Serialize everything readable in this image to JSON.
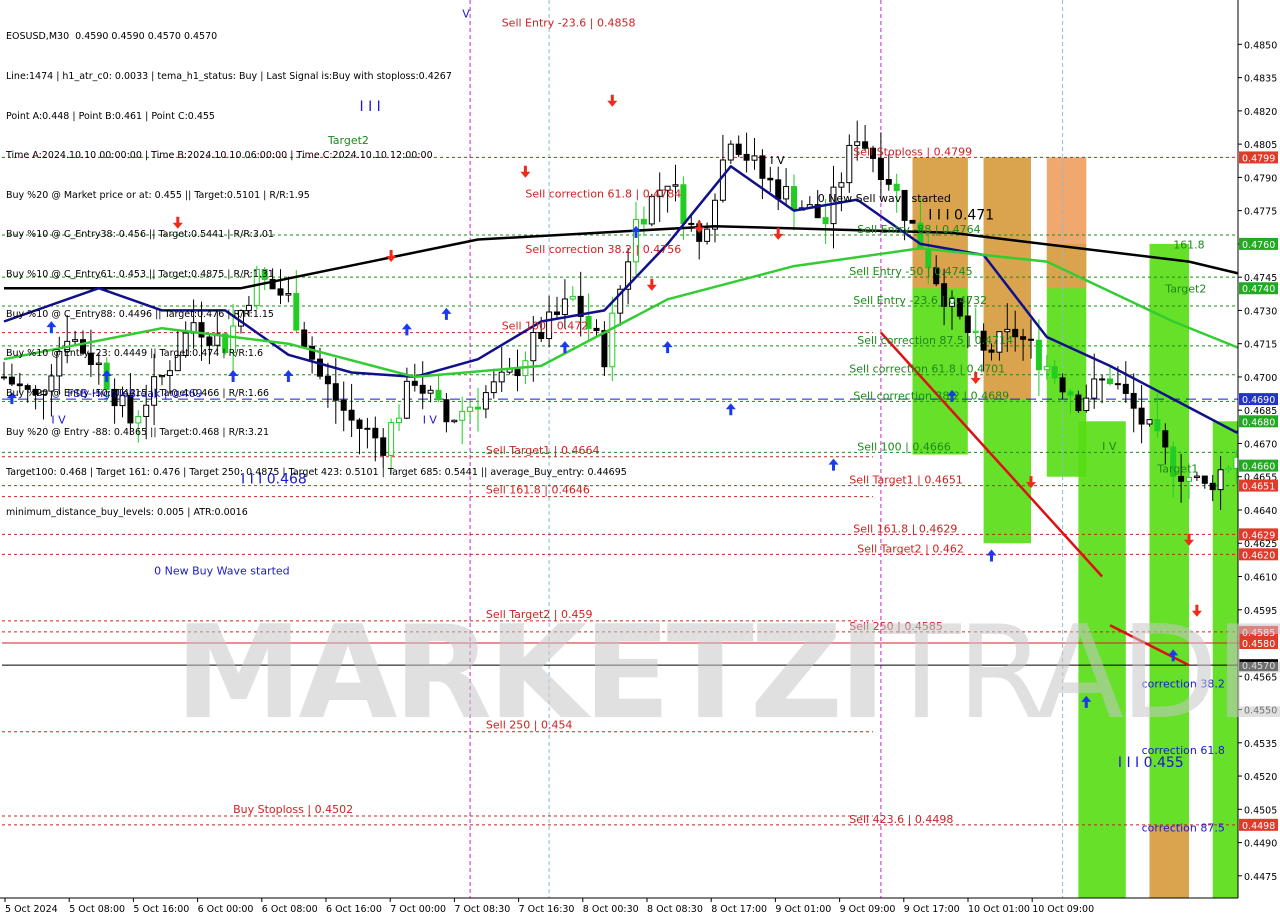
{
  "symbol": "EOSUSD,M30",
  "ohlc": "0.4590 0.4590 0.4570 0.4570",
  "info_lines": [
    "Line:1474 | h1_atr_c0: 0.0033 | tema_h1_status: Buy | Last Signal is:Buy with stoploss:0.4267",
    "Point A:0.448 | Point B:0.461 | Point C:0.455",
    "Time A:2024.10.10 00:00:00 | Time B:2024.10.10 06:00:00 | Time C:2024.10.10 12:00:00",
    "Buy %20 @ Market price or at: 0.455 || Target:0.5101 | R/R:1.95",
    "Buy %10 @ C_Entry38: 0.456 || Target:0.5441 | R/R:3.01",
    "Buy %10 @ C_Entry61: 0.453 || Target:0.4875 | R/R:1.31",
    "Buy %10 @ C_Entry88: 0.4496 || Target:0.476 | R/R:1.15",
    "Buy %10 @ Entry -23: 0.4449 || Target:0.474 | R/R:1.6",
    "Buy %20 @ Entry -50: 0.4415 || Target:0.466 | R/R:1.66",
    "Buy %20 @ Entry -88: 0.4365 || Target:0.468 | R/R:3.21",
    "Target100: 0.468 | Target 161: 0.476 | Target 250: 0.4875 | Target 423: 0.5101 | Target 685: 0.5441 || average_Buy_entry: 0.44695",
    "minimum_distance_buy_levels: 0.005 | ATR:0.0016"
  ],
  "watermark": {
    "bold": "MARKETZI",
    "light": "TRADE"
  },
  "colors": {
    "background": "#ffffff",
    "candle": "#000000",
    "candle_green": "#22cc22",
    "ma_black": "#000000",
    "ma_navy": "#10108a",
    "ma_green": "#33cc33",
    "level_red": "#cc2222",
    "level_green": "#1a8a1a",
    "level_blue": "#1a1acc",
    "zone_green": "#55dd11",
    "zone_orange": "#ee9955",
    "price_label_red": "#e03a2a",
    "price_label_green": "#22aa22",
    "price_label_blue": "#2233cc",
    "price_label_black": "#000000",
    "signal_up": "#1a3aee",
    "signal_down": "#ee2a1a"
  },
  "chart_data": {
    "type": "candlestick",
    "symbol": "EOSUSD",
    "timeframe": "M30",
    "ylim": [
      0.4465,
      0.487
    ],
    "y_ticks": [
      "0.4850",
      "0.4835",
      "0.4820",
      "0.4805",
      "0.4790",
      "0.4775",
      "0.4760",
      "0.4745",
      "0.4730",
      "0.4715",
      "0.4700",
      "0.4685",
      "0.4670",
      "0.4655",
      "0.4640",
      "0.4625",
      "0.4610",
      "0.4595",
      "0.4580",
      "0.4565",
      "0.4550",
      "0.4535",
      "0.4520",
      "0.4505",
      "0.4490",
      "0.4475"
    ],
    "x_labels": [
      "5 Oct 2024",
      "5 Oct 08:00",
      "5 Oct 16:00",
      "6 Oct 00:00",
      "6 Oct 08:00",
      "6 Oct 16:00",
      "7 Oct 00:00",
      "7 Oct 08:30",
      "7 Oct 16:30",
      "8 Oct 00:30",
      "8 Oct 08:30",
      "8 Oct 17:00",
      "9 Oct 01:00",
      "9 Oct 09:00",
      "9 Oct 17:00",
      "10 Oct 01:00",
      "10 Oct 09:00"
    ],
    "current_price": 0.457,
    "close_path": [
      [
        0,
        0.47
      ],
      [
        4,
        0.469
      ],
      [
        8,
        0.472
      ],
      [
        12,
        0.4705
      ],
      [
        16,
        0.468
      ],
      [
        20,
        0.47
      ],
      [
        24,
        0.4725
      ],
      [
        28,
        0.4715
      ],
      [
        32,
        0.4745
      ],
      [
        36,
        0.4735
      ],
      [
        40,
        0.47
      ],
      [
        44,
        0.468
      ],
      [
        48,
        0.467
      ],
      [
        52,
        0.47
      ],
      [
        56,
        0.468
      ],
      [
        60,
        0.469
      ],
      [
        64,
        0.47
      ],
      [
        68,
        0.472
      ],
      [
        72,
        0.4735
      ],
      [
        76,
        0.471
      ],
      [
        80,
        0.477
      ],
      [
        84,
        0.479
      ],
      [
        88,
        0.476
      ],
      [
        92,
        0.481
      ],
      [
        96,
        0.479
      ],
      [
        100,
        0.478
      ],
      [
        104,
        0.477
      ],
      [
        108,
        0.481
      ],
      [
        112,
        0.479
      ],
      [
        116,
        0.476
      ],
      [
        120,
        0.473
      ],
      [
        124,
        0.471
      ],
      [
        128,
        0.472
      ],
      [
        132,
        0.4705
      ],
      [
        136,
        0.469
      ],
      [
        140,
        0.47
      ],
      [
        144,
        0.468
      ],
      [
        148,
        0.466
      ],
      [
        152,
        0.465
      ],
      [
        156,
        0.4665
      ],
      [
        160,
        0.468
      ],
      [
        164,
        0.469
      ],
      [
        168,
        0.47
      ],
      [
        172,
        0.4695
      ],
      [
        176,
        0.469
      ],
      [
        180,
        0.468
      ],
      [
        184,
        0.467
      ],
      [
        188,
        0.466
      ],
      [
        192,
        0.465
      ],
      [
        196,
        0.464
      ],
      [
        200,
        0.4625
      ],
      [
        204,
        0.46
      ],
      [
        208,
        0.456
      ],
      [
        212,
        0.451
      ],
      [
        216,
        0.453
      ],
      [
        220,
        0.456
      ],
      [
        224,
        0.459
      ],
      [
        228,
        0.46
      ],
      [
        232,
        0.459
      ],
      [
        236,
        0.461
      ],
      [
        240,
        0.46
      ],
      [
        244,
        0.459
      ],
      [
        248,
        0.457
      ]
    ],
    "moving_averages": [
      {
        "color": "black",
        "points": [
          [
            0,
            0.474
          ],
          [
            30,
            0.474
          ],
          [
            60,
            0.4762
          ],
          [
            90,
            0.4768
          ],
          [
            120,
            0.4765
          ],
          [
            150,
            0.4752
          ],
          [
            170,
            0.4735
          ],
          [
            190,
            0.4712
          ],
          [
            205,
            0.4688
          ],
          [
            220,
            0.4674
          ]
        ]
      },
      {
        "color": "navy",
        "points": [
          [
            0,
            0.4725
          ],
          [
            12,
            0.474
          ],
          [
            20,
            0.473
          ],
          [
            28,
            0.473
          ],
          [
            36,
            0.471
          ],
          [
            44,
            0.4702
          ],
          [
            52,
            0.47
          ],
          [
            60,
            0.4708
          ],
          [
            68,
            0.4725
          ],
          [
            76,
            0.473
          ],
          [
            84,
            0.476
          ],
          [
            92,
            0.4795
          ],
          [
            100,
            0.4775
          ],
          [
            108,
            0.478
          ],
          [
            116,
            0.476
          ],
          [
            124,
            0.4755
          ],
          [
            132,
            0.4718
          ],
          [
            140,
            0.4705
          ],
          [
            148,
            0.469
          ],
          [
            156,
            0.4675
          ],
          [
            164,
            0.469
          ],
          [
            172,
            0.4695
          ],
          [
            180,
            0.4692
          ],
          [
            188,
            0.469
          ],
          [
            196,
            0.467
          ],
          [
            204,
            0.4625
          ],
          [
            210,
            0.46
          ],
          [
            218,
            0.459
          ],
          [
            226,
            0.459
          ],
          [
            234,
            0.459
          ],
          [
            240,
            0.4592
          ],
          [
            244,
            0.4598
          ],
          [
            248,
            0.459
          ]
        ]
      },
      {
        "color": "green",
        "points": [
          [
            0,
            0.4708
          ],
          [
            20,
            0.4722
          ],
          [
            36,
            0.4715
          ],
          [
            52,
            0.47
          ],
          [
            68,
            0.4705
          ],
          [
            84,
            0.4735
          ],
          [
            100,
            0.475
          ],
          [
            116,
            0.4758
          ],
          [
            132,
            0.4752
          ],
          [
            148,
            0.4725
          ],
          [
            164,
            0.4702
          ],
          [
            180,
            0.47
          ],
          [
            196,
            0.469
          ],
          [
            208,
            0.466
          ],
          [
            220,
            0.4625
          ],
          [
            232,
            0.461
          ],
          [
            242,
            0.46
          ],
          [
            248,
            0.4595
          ]
        ]
      }
    ],
    "levels": [
      {
        "name": "FSB-HighToBreak",
        "price": 0.469,
        "color": "blue",
        "style": "dash",
        "label": "FSB-HighToBreak | 0.469",
        "tag": "0.4690"
      },
      {
        "name": "Sell Stoploss",
        "price": 0.4799,
        "color": "red",
        "style": "dot",
        "label": "Sell Stoploss | 0.4799",
        "tag": "0.4799"
      },
      {
        "name": "Sell Entry -88",
        "price": 0.4764,
        "color": "green",
        "style": "dot",
        "label": "Sell Entry -88 | 0.4764",
        "tag": "0.4760"
      },
      {
        "name": "Sell Entry -50",
        "price": 0.4745,
        "color": "green",
        "style": "dot",
        "label": "Sell Entry -50 | 0.4745",
        "tag": "0.4740"
      },
      {
        "name": "Sell Entry -23.6",
        "price": 0.4732,
        "color": "green",
        "style": "dot",
        "label": "Sell Entry -23.6 | 0.4732",
        "tag": ""
      },
      {
        "name": "Sell correction 87.5",
        "price": 0.4714,
        "color": "green",
        "style": "dot",
        "label": "Sell correction 87.5 | 0.4714",
        "tag": ""
      },
      {
        "name": "Sell correction 61.8",
        "price": 0.4701,
        "color": "green",
        "style": "dot",
        "label": "Sell correction 61.8 | 0.4701",
        "tag": ""
      },
      {
        "name": "Sell correction 38.2",
        "price": 0.4689,
        "color": "green",
        "style": "dot",
        "label": "Sell correction 38.2 | 0.4689",
        "tag": "0.4680"
      },
      {
        "name": "Sell 100",
        "price": 0.4666,
        "color": "green",
        "style": "dot",
        "label": "Sell 100 | 0.4666",
        "tag": "0.4660"
      },
      {
        "name": "Sell Target1",
        "price": 0.4651,
        "color": "red",
        "style": "dot",
        "label": "Sell Target1 | 0.4651",
        "tag": "0.4651"
      },
      {
        "name": "Sell 161.8",
        "price": 0.4629,
        "color": "red",
        "style": "dot",
        "label": "Sell 161.8 | 0.4629",
        "tag": "0.4629"
      },
      {
        "name": "Sell Target2",
        "price": 0.462,
        "color": "red",
        "style": "dot",
        "label": "Sell Target2 | 0.462",
        "tag": "0.4620"
      },
      {
        "name": "Sell 250",
        "price": 0.4585,
        "color": "red",
        "style": "dot",
        "label": "Sell 250 | 0.4585",
        "tag": "0.4585"
      },
      {
        "name": "Current",
        "price": 0.458,
        "color": "red",
        "style": "solid",
        "label": "",
        "tag": "0.4580"
      },
      {
        "name": "Bid",
        "price": 0.457,
        "color": "black",
        "style": "solid",
        "label": "",
        "tag": "0.4570"
      },
      {
        "name": "Sell 423.6",
        "price": 0.4498,
        "color": "red",
        "style": "dot",
        "label": "Sell 423.6 | 0.4498",
        "tag": "0.4498"
      }
    ],
    "old_levels": [
      {
        "price": 0.4664,
        "label": "Sell Target1 | 0.4664"
      },
      {
        "price": 0.4646,
        "label": "Sell 161.8 | 0.4646"
      },
      {
        "price": 0.459,
        "label": "Sell Target2 | 0.459"
      },
      {
        "price": 0.454,
        "label": "Sell 250 | 0.454"
      },
      {
        "price": 0.4502,
        "label": "Buy Stoploss | 0.4502"
      },
      {
        "price": 0.472,
        "label": "Sell 100 | 0.472"
      }
    ],
    "text_annotations": [
      {
        "text": "Sell Entry -23.6 | 0.4858",
        "x": 63,
        "y": 0.4858,
        "color": "red"
      },
      {
        "text": "Sell correction 61.8 | 0.4784",
        "x": 66,
        "y": 0.4781,
        "color": "red"
      },
      {
        "text": "Sell correction 38.2 | 0.4756",
        "x": 66,
        "y": 0.4756,
        "color": "red"
      },
      {
        "text": "0 New Sell wave started",
        "x": 103,
        "y": 0.4779,
        "color": "black"
      },
      {
        "text": "0 New Buy Wave started",
        "x": 19,
        "y": 0.4611,
        "color": "blue"
      },
      {
        "text": "I I I 0.471",
        "x": 117,
        "y": 0.4771,
        "color": "black"
      },
      {
        "text": "I I I 0.468",
        "x": 30,
        "y": 0.4652,
        "color": "blue"
      },
      {
        "text": "I I I 0.455",
        "x": 141,
        "y": 0.4524,
        "color": "blue"
      },
      {
        "text": "I V",
        "x": 6,
        "y": 0.4679,
        "color": "blue"
      },
      {
        "text": "I V",
        "x": 53,
        "y": 0.4679,
        "color": "blue"
      },
      {
        "text": "I V",
        "x": 97,
        "y": 0.4796,
        "color": "black"
      },
      {
        "text": "I V",
        "x": 139,
        "y": 0.4667,
        "color": "green"
      },
      {
        "text": "I I I",
        "x": 45,
        "y": 0.482,
        "color": "blue"
      },
      {
        "text": "V",
        "x": 58,
        "y": 0.4862,
        "color": "blue"
      },
      {
        "text": "Target2",
        "x": 41,
        "y": 0.4805,
        "color": "green"
      },
      {
        "text": "161.8",
        "x": 148,
        "y": 0.4758,
        "color": "green"
      },
      {
        "text": "Target2",
        "x": 147,
        "y": 0.4738,
        "color": "green"
      },
      {
        "text": "Target1",
        "x": 146,
        "y": 0.4657,
        "color": "green"
      },
      {
        "text": "correction 38.2",
        "x": 144,
        "y": 0.456,
        "color": "blue"
      },
      {
        "text": "correction 61.8",
        "x": 144,
        "y": 0.453,
        "color": "blue"
      },
      {
        "text": "correction 87.5",
        "x": 144,
        "y": 0.4495,
        "color": "blue"
      }
    ],
    "zones": [
      {
        "x0": 115,
        "x1": 122,
        "y0": 0.4665,
        "y1": 0.4799,
        "color": "green"
      },
      {
        "x0": 115,
        "x1": 122,
        "y0": 0.474,
        "y1": 0.4799,
        "color": "orange"
      },
      {
        "x0": 124,
        "x1": 130,
        "y0": 0.4625,
        "y1": 0.4799,
        "color": "green"
      },
      {
        "x0": 124,
        "x1": 130,
        "y0": 0.469,
        "y1": 0.4799,
        "color": "orange"
      },
      {
        "x0": 132,
        "x1": 137,
        "y0": 0.4655,
        "y1": 0.476,
        "color": "green"
      },
      {
        "x0": 132,
        "x1": 137,
        "y0": 0.474,
        "y1": 0.4799,
        "color": "orange"
      },
      {
        "x0": 136,
        "x1": 142,
        "y0": 0.4465,
        "y1": 0.468,
        "color": "green"
      },
      {
        "x0": 145,
        "x1": 150,
        "y0": 0.4465,
        "y1": 0.476,
        "color": "green"
      },
      {
        "x0": 145,
        "x1": 150,
        "y0": 0.4465,
        "y1": 0.4498,
        "color": "orange"
      },
      {
        "x0": 153,
        "x1": 158,
        "y0": 0.4465,
        "y1": 0.468,
        "color": "green"
      }
    ],
    "trend_lines": [
      {
        "x0": 111,
        "y0": 0.472,
        "x1": 139,
        "y1": 0.461
      },
      {
        "x0": 140,
        "y0": 0.4588,
        "x1": 150,
        "y1": 0.457
      }
    ],
    "vertical_lines": [
      {
        "x": 59,
        "color": "magenta"
      },
      {
        "x": 111,
        "color": "magenta"
      },
      {
        "x": 69,
        "color": "lightblue"
      },
      {
        "x": 134,
        "color": "lightblue"
      }
    ],
    "signals": [
      {
        "x": 1,
        "y": 0.469,
        "dir": "up"
      },
      {
        "x": 6,
        "y": 0.4722,
        "dir": "up"
      },
      {
        "x": 13,
        "y": 0.47,
        "dir": "up"
      },
      {
        "x": 29,
        "y": 0.47,
        "dir": "up"
      },
      {
        "x": 36,
        "y": 0.47,
        "dir": "up"
      },
      {
        "x": 51,
        "y": 0.4721,
        "dir": "up"
      },
      {
        "x": 56,
        "y": 0.4728,
        "dir": "up"
      },
      {
        "x": 71,
        "y": 0.4713,
        "dir": "up"
      },
      {
        "x": 80,
        "y": 0.4765,
        "dir": "up"
      },
      {
        "x": 84,
        "y": 0.4713,
        "dir": "up"
      },
      {
        "x": 92,
        "y": 0.4685,
        "dir": "up"
      },
      {
        "x": 105,
        "y": 0.466,
        "dir": "up"
      },
      {
        "x": 120,
        "y": 0.4691,
        "dir": "up"
      },
      {
        "x": 125,
        "y": 0.4619,
        "dir": "up"
      },
      {
        "x": 137,
        "y": 0.4553,
        "dir": "up"
      },
      {
        "x": 148,
        "y": 0.4574,
        "dir": "up"
      },
      {
        "x": 22,
        "y": 0.477,
        "dir": "down"
      },
      {
        "x": 49,
        "y": 0.4755,
        "dir": "down"
      },
      {
        "x": 66,
        "y": 0.4793,
        "dir": "down"
      },
      {
        "x": 77,
        "y": 0.4825,
        "dir": "down"
      },
      {
        "x": 82,
        "y": 0.4742,
        "dir": "down"
      },
      {
        "x": 88,
        "y": 0.4768,
        "dir": "down"
      },
      {
        "x": 98,
        "y": 0.4765,
        "dir": "down"
      },
      {
        "x": 123,
        "y": 0.47,
        "dir": "down"
      },
      {
        "x": 130,
        "y": 0.4653,
        "dir": "down"
      },
      {
        "x": 150,
        "y": 0.4627,
        "dir": "down"
      },
      {
        "x": 151,
        "y": 0.4595,
        "dir": "down"
      }
    ],
    "legend_position": "top-left",
    "grid": false
  }
}
